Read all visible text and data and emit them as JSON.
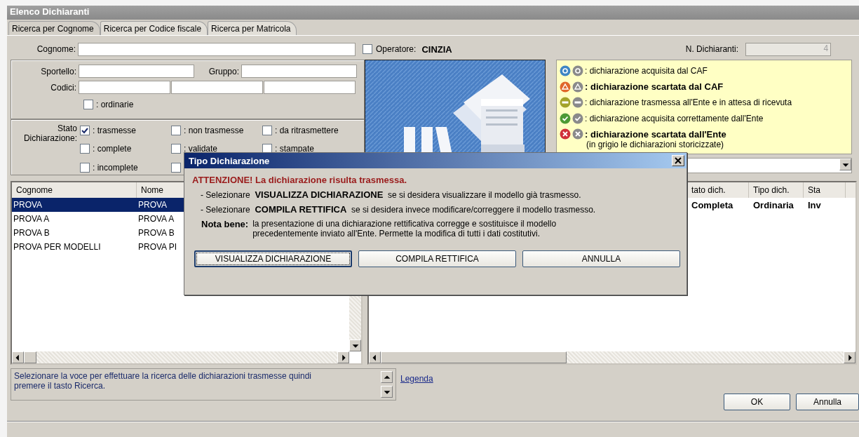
{
  "window": {
    "title": "Elenco Dichiaranti"
  },
  "tabs": [
    {
      "label": "Ricerca per Cognome",
      "selected": true
    },
    {
      "label": "Ricerca per Codice fiscale",
      "selected": false
    },
    {
      "label": "Ricerca per Matricola",
      "selected": false
    }
  ],
  "search": {
    "cognome_label": "Cognome:",
    "operator_checked": false,
    "operator_label": "Operatore:",
    "operator": "CINZIA",
    "count_label": "N. Dichiaranti:",
    "count": "4"
  },
  "filters": {
    "sportello_label": "Sportello:",
    "gruppo_label": "Gruppo:",
    "codici_label": "Codici:",
    "ordinarie": {
      "label": ": ordinarie",
      "checked": false
    }
  },
  "stato": {
    "label_lines": [
      "Stato",
      "Dichiarazione:"
    ],
    "options": [
      {
        "label": ": trasmesse",
        "checked": true
      },
      {
        "label": ": non trasmesse",
        "checked": false
      },
      {
        "label": ": da ritrasmettere",
        "checked": false
      },
      {
        "label": ": complete",
        "checked": false
      },
      {
        "label": ": validate",
        "checked": false
      },
      {
        "label": ": stampate",
        "checked": false
      },
      {
        "label": ": incomplete",
        "checked": false
      },
      {
        "checked": false
      }
    ]
  },
  "legend": {
    "items": [
      {
        "kind": "ring",
        "color": "#3f86c4",
        "text": ": dichiarazione acquisita dal CAF",
        "emphasized": false
      },
      {
        "kind": "triangle",
        "color": "#e0672a",
        "text": ": dichiarazione scartata dal CAF",
        "emphasized": true
      },
      {
        "kind": "dots",
        "color": "#a3a32a",
        "text": ": dichiarazione trasmessa all'Ente e in attesa di ricevuta",
        "emphasized": false
      },
      {
        "kind": "check",
        "color": "#4c9a34",
        "text": ": dichiarazione acquisita correttamente dall'Ente",
        "emphasized": false
      },
      {
        "kind": "cross",
        "color": "#d0303a",
        "text": ": dichiarazione scartata dall'Ente",
        "emphasized": true
      }
    ],
    "note": "(in grigio le dichiarazioni storicizzate)"
  },
  "list_left": {
    "columns": [
      "Cognome",
      "Nome"
    ],
    "rows": [
      {
        "cells": [
          "PROVA",
          "PROVA"
        ],
        "selected": true
      },
      {
        "cells": [
          "PROVA A",
          "PROVA A"
        ],
        "selected": false
      },
      {
        "cells": [
          "PROVA B",
          "PROVA B"
        ],
        "selected": false
      },
      {
        "cells": [
          "PROVA PER MODELLI",
          "PROVA PI"
        ],
        "selected": false
      }
    ]
  },
  "list_right": {
    "columns": [
      "tato dich.",
      "Tipo dich.",
      "Sta"
    ],
    "rows": [
      {
        "cells": [
          "Completa",
          "Ordinaria",
          "Inv"
        ]
      }
    ]
  },
  "message": "Selezionare la voce per effettuare la ricerca delle dichiarazioni trasmesse quindi premere il tasto Ricerca.",
  "legend_link": "Legenda",
  "buttons": [
    "OK",
    "Annulla"
  ],
  "dialog": {
    "title": "Tipo Dichiarazione",
    "heading": "ATTENZIONE! La dichiarazione risulta trasmessa.",
    "lines": [
      "- Selezionare  **VISUALIZZA DICHIARAZIONE**  se si desidera visualizzare il modello già trasmesso.",
      "- Selezionare  **COMPILA RETTIFICA**  se si desidera invece modificare/correggere il modello trasmesso."
    ],
    "note_label": "Nota bene:",
    "note": "la presentazione di una dichiarazione rettificativa corregge e sostituisce il modello precedentemente inviato all'Ente. Permette la modifica di tutti i dati costitutivi.",
    "buttons": [
      {
        "label": "VISUALIZZA DICHIARAZIONE",
        "focused": true
      },
      {
        "label": "COMPILA RETTIFICA",
        "focused": false
      },
      {
        "label": "ANNULLA",
        "focused": false
      }
    ]
  }
}
